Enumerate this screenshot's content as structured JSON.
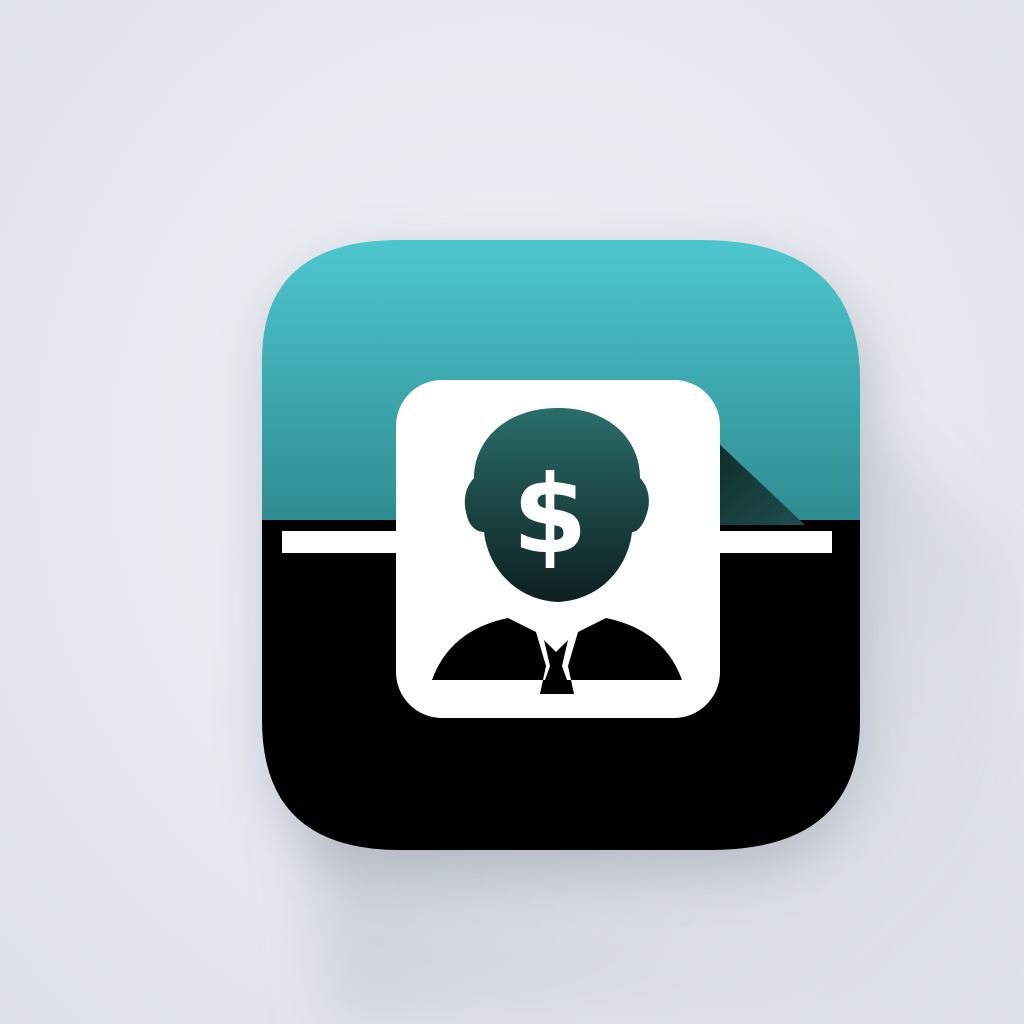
{
  "app_icon": {
    "name": "finance-person-app-icon",
    "glyph": {
      "symbol": "$",
      "icon": "person-with-dollar-head-icon"
    },
    "colors": {
      "background": "#e7eaf0",
      "top_gradient_start": "#4ec9d1",
      "top_gradient_end": "#2e8a8e",
      "bottom": "#000000",
      "card": "#ffffff",
      "head_top": "#2a6e6c",
      "head_bottom": "#0d1f1f",
      "symbol": "#ffffff"
    }
  }
}
